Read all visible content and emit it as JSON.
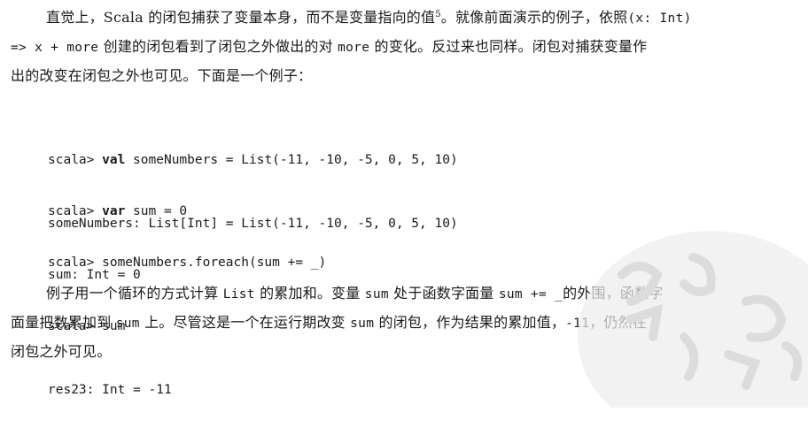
{
  "paragraph1": {
    "l1_a": "直觉上，Scala 的闭包捕获了变量本身，而不是变量指向的值",
    "l1_sup": "5",
    "l1_b": "。就像前面演示的例子，依照",
    "l1_code": "(x: Int)",
    "l2_code1": "=> x + more",
    "l2_a": " 创建的闭包看到了闭包之外做出的对 ",
    "l2_code2": "more",
    "l2_b": " 的变化。反过来也同样。闭包对捕获变量作",
    "l3": "出的改变在闭包之外也可见。下面是一个例子："
  },
  "code_block_1": {
    "prompt": "scala> ",
    "kw": "val",
    "rest": " someNumbers = List(-11, -10, -5, 0, 5, 10)",
    "output": "someNumbers: List[Int] = List(-11, -10, -5, 0, 5, 10)"
  },
  "code_block_2": {
    "prompt": "scala> ",
    "kw": "var",
    "rest": " sum = 0",
    "output": "sum: Int = 0"
  },
  "code_block_3": {
    "line1": "scala> someNumbers.foreach(sum += _)",
    "line2": "scala> sum",
    "line3": "res23: Int = -11"
  },
  "paragraph2": {
    "l1_a": "例子用一个循环的方式计算 ",
    "l1_code1": "List",
    "l1_b": " 的累加和。变量 ",
    "l1_code2": "sum",
    "l1_c": " 处于函数字面量 ",
    "l1_code3": "sum += _",
    "l1_d": "的外围，函数字",
    "l2_a": "面量把数累加到 ",
    "l2_code1": "sum",
    "l2_b": " 上。尽管这是一个在运行期改变 ",
    "l2_code2": "sum",
    "l2_c": " 的闭包，作为结果的累加值，",
    "l2_code3": "-11",
    "l2_d": "，仍然在",
    "l3": "闭包之外可见。"
  },
  "watermark": {
    "icon": "stamp-watermark",
    "color": "#d9d9d9"
  }
}
